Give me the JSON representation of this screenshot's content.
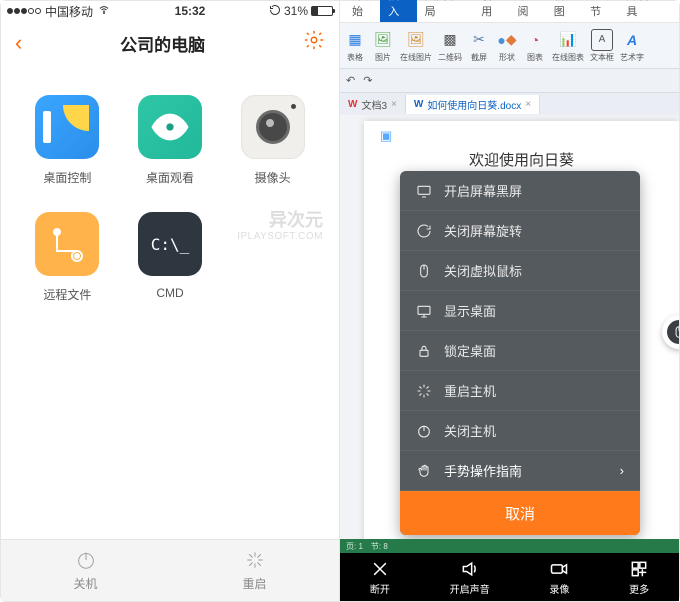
{
  "left": {
    "status": {
      "carrier": "中国移动",
      "time": "15:32",
      "battery_pct": "31%"
    },
    "title": "公司的电脑",
    "tiles": [
      {
        "label": "桌面控制"
      },
      {
        "label": "桌面观看"
      },
      {
        "label": "摄像头"
      },
      {
        "label": "远程文件"
      },
      {
        "label": "CMD"
      }
    ],
    "cmd_text": "C:\\_",
    "watermark": {
      "main": "异次元",
      "sub": "IPLAYSOFT.COM"
    },
    "bottom": {
      "shutdown": "关机",
      "restart": "重启"
    }
  },
  "right": {
    "ribbon_tabs": [
      "开始",
      "插入",
      "页面布局",
      "引用",
      "审阅",
      "视图",
      "章节",
      "开发工具"
    ],
    "ribbon_active_index": 1,
    "ribbon_groups": [
      "表格",
      "图片",
      "在线图片",
      "二维码",
      "截屏",
      "形状",
      "图表",
      "在线图表",
      "文本框",
      "艺术字"
    ],
    "doc_tabs": [
      {
        "label": "文档3",
        "icon": "w",
        "active": false
      },
      {
        "label": "如何使用向日葵.docx",
        "icon": "w",
        "active": true
      }
    ],
    "page_heading": "欢迎使用向日葵",
    "menu": [
      "开启屏幕黑屏",
      "关闭屏幕旋转",
      "关闭虚拟鼠标",
      "显示桌面",
      "锁定桌面",
      "重启主机",
      "关闭主机",
      "手势操作指南"
    ],
    "menu_cancel": "取消",
    "status_strip": [
      "页: 1",
      "节: 8"
    ],
    "toolbar": [
      "断开",
      "开启声音",
      "录像",
      "更多"
    ]
  }
}
